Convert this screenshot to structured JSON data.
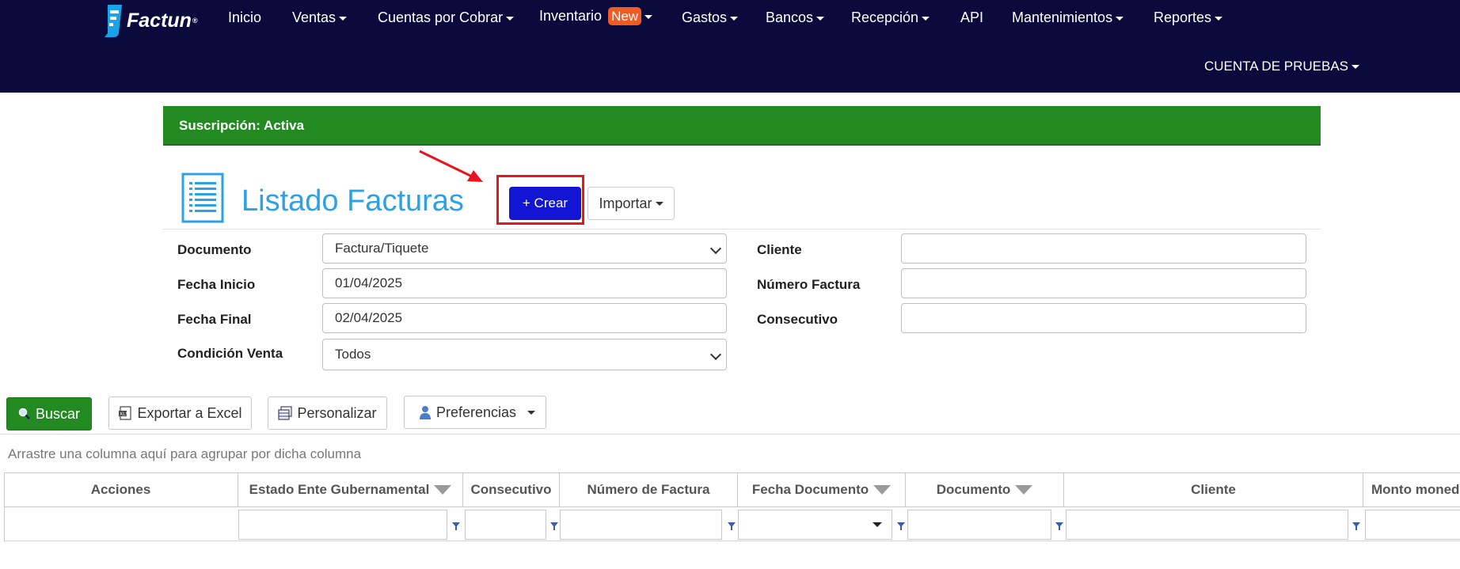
{
  "nav": {
    "brand": "Factun",
    "brand_mark": "®",
    "items": [
      {
        "label": "Inicio",
        "dropdown": false
      },
      {
        "label": "Ventas",
        "dropdown": true
      },
      {
        "label": "Cuentas por Cobrar",
        "dropdown": true
      },
      {
        "label": "Inventario",
        "dropdown": true,
        "badge": "New"
      },
      {
        "label": "Gastos",
        "dropdown": true
      },
      {
        "label": "Bancos",
        "dropdown": true
      },
      {
        "label": "Recepción",
        "dropdown": true
      },
      {
        "label": "API",
        "dropdown": false
      },
      {
        "label": "Mantenimientos",
        "dropdown": true
      },
      {
        "label": "Reportes",
        "dropdown": true
      }
    ],
    "account": "CUENTA DE PRUEBAS"
  },
  "subscription": "Suscripción: Activa",
  "page": {
    "title": "Listado Facturas",
    "create_button": "+ Crear",
    "import_button": "Importar"
  },
  "filters": {
    "documento": {
      "label": "Documento",
      "value": "Factura/Tiquete"
    },
    "fecha_inicio": {
      "label": "Fecha Inicio",
      "value": "01/04/2025"
    },
    "fecha_final": {
      "label": "Fecha Final",
      "value": "02/04/2025"
    },
    "condicion_venta": {
      "label": "Condición Venta",
      "value": "Todos"
    },
    "cliente": {
      "label": "Cliente",
      "value": ""
    },
    "numero_factura": {
      "label": "Número Factura",
      "value": ""
    },
    "consecutivo": {
      "label": "Consecutivo",
      "value": ""
    }
  },
  "toolbar": {
    "buscar": "Buscar",
    "exportar": "Exportar a Excel",
    "personalizar": "Personalizar",
    "preferencias": "Preferencias"
  },
  "grid": {
    "group_hint": "Arrastre una columna aquí para agrupar por dicha columna",
    "columns": [
      "Acciones",
      "Estado Ente Gubernamental",
      "Consecutivo",
      "Número de Factura",
      "Fecha Documento",
      "Documento",
      "Cliente",
      "Monto moned"
    ]
  },
  "colors": {
    "navbar": "#0b0a3c",
    "subscription_bar": "#238a22",
    "title": "#2da1e6",
    "create_button": "#1315d4",
    "highlight": "#e8141e",
    "badge": "#f05a24"
  }
}
